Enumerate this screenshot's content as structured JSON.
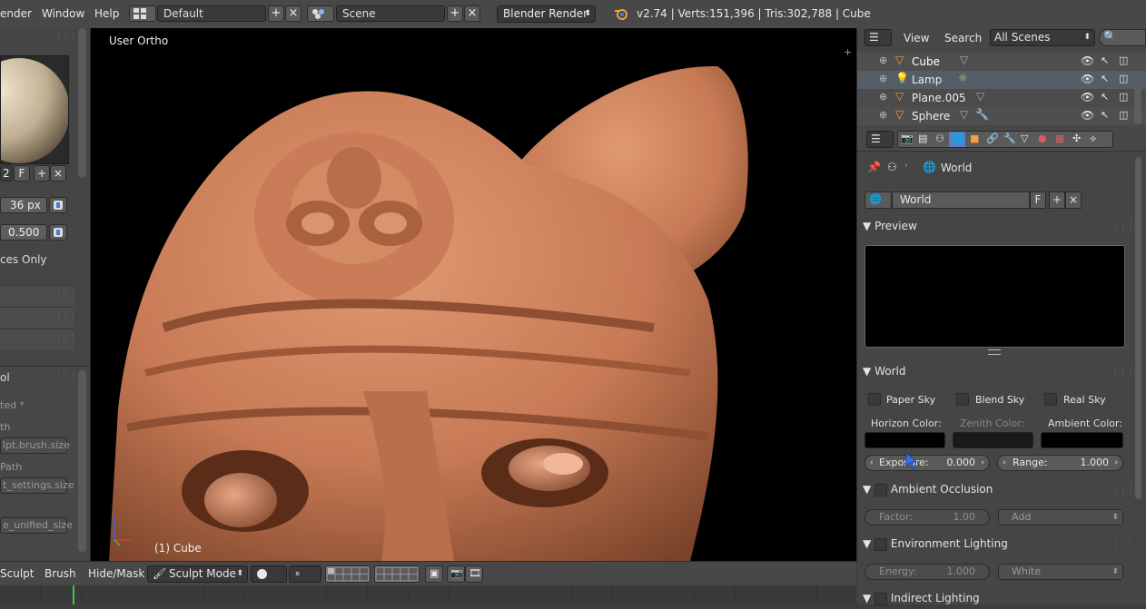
{
  "topbar": {
    "menu_render": "ender",
    "menu_window": "Window",
    "menu_help": "Help",
    "screen_layout": "Default",
    "scene": "Scene",
    "render_engine": "Blender Render",
    "stats": "v2.74 | Verts:151,396 | Tris:302,788 | Cube"
  },
  "left_panel": {
    "slot_number": "2",
    "fake_user": "F",
    "radius_value": "36 px",
    "strength_value": "0.500",
    "faces_only": "ces Only",
    "section_label": "ol",
    "edited_label": "ted *",
    "path_label_1": "th",
    "path_field_1": "lpt.brush.size",
    "path_label_2": "Path",
    "path_field_2": "t_settings.size",
    "path_field_3": "e_unified_size"
  },
  "viewport": {
    "view_label": "User Ortho",
    "object_label": "(1) Cube"
  },
  "bottombar": {
    "menu_sculpt": "Sculpt",
    "menu_brush": "Brush",
    "menu_hideMask": "Hide/Mask",
    "mode": "Sculpt Mode"
  },
  "outliner": {
    "menu_view": "View",
    "menu_search": "Search",
    "display_mode": "All Scenes",
    "rows": [
      {
        "name": "Cube"
      },
      {
        "name": "Lamp"
      },
      {
        "name": "Plane.005"
      },
      {
        "name": "Sphere"
      }
    ]
  },
  "properties": {
    "context": "World",
    "datablock_name": "World",
    "fake_user": "F",
    "preview_header": "Preview",
    "world_header": "World",
    "paper_sky": "Paper Sky",
    "blend_sky": "Blend Sky",
    "real_sky": "Real Sky",
    "horizon_color": "Horizon Color:",
    "zenith_color": "Zenith Color:",
    "ambient_color": "Ambient Color:",
    "exposure_label": "Exposure:",
    "exposure_value": "0.000",
    "range_label": "Range:",
    "range_value": "1.000",
    "ao_header": "Ambient Occlusion",
    "factor_label": "Factor:",
    "factor_value": "1.00",
    "blend_mode": "Add",
    "env_header": "Environment Lighting",
    "energy_label": "Energy:",
    "energy_value": "1.000",
    "env_color": "White",
    "indirect_header": "Indirect Lighting"
  },
  "colors": {
    "accent_blue": "#5680c2",
    "sculpt_clay": "#c77a55",
    "timeline_green": "#3ec83e"
  }
}
